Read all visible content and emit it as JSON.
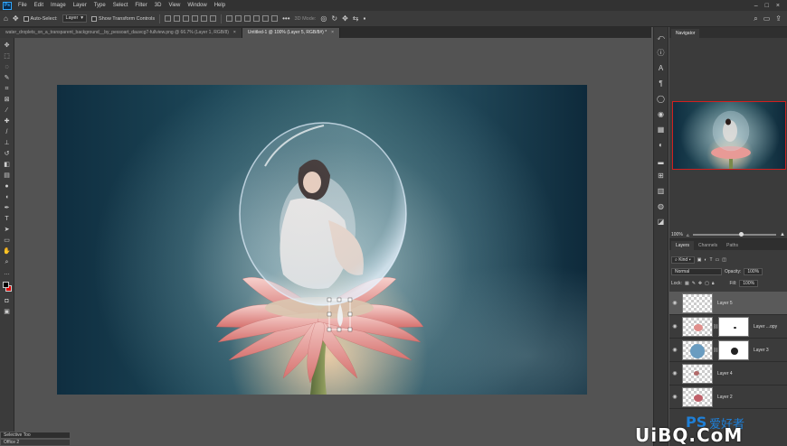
{
  "app": {
    "logo": "Ps",
    "menu": [
      "File",
      "Edit",
      "Image",
      "Layer",
      "Type",
      "Select",
      "Filter",
      "3D",
      "View",
      "Window",
      "Help"
    ]
  },
  "options_bar": {
    "auto_select_label": "Auto-Select:",
    "auto_select_target": "Layer",
    "show_transform_label": "Show Transform Controls",
    "mode_3d_label": "3D Mode:"
  },
  "tabs": [
    {
      "label": "water_droplets_on_a_transparent_background__by_pessoart_dauvcg7-fullview.png @ 66.7% (Layer 1, RGB/8)",
      "close": "×"
    },
    {
      "label": "Untitled-1 @ 100% (Layer 5, RGB/8#) *",
      "close": "×"
    }
  ],
  "colors": {
    "foreground": "#000000",
    "background": "#e00000",
    "accent": "#31a8ff"
  },
  "navigator": {
    "tabs": [
      "Navigator"
    ],
    "zoom": "100%"
  },
  "layers_panel": {
    "tabs": [
      "Layers",
      "Channels",
      "Paths"
    ],
    "filter_kind": "Kind",
    "blend_mode": "Normal",
    "opacity_label": "Opacity:",
    "opacity_value": "100%",
    "lock_label": "Lock:",
    "fill_label": "Fill:",
    "fill_value": "100%",
    "layers": [
      {
        "name": "Layer 5",
        "visible": true,
        "selected": true,
        "mask": false
      },
      {
        "name": "Layer ...opy",
        "visible": true,
        "selected": false,
        "mask": true
      },
      {
        "name": "Layer 3",
        "visible": true,
        "selected": false,
        "mask": true
      },
      {
        "name": "Layer 4",
        "visible": true,
        "selected": false,
        "mask": false
      },
      {
        "name": "Layer 2",
        "visible": true,
        "selected": false,
        "mask": false
      }
    ]
  },
  "bottom": {
    "selective": "Selective Too",
    "status": "Office 2"
  },
  "watermark": {
    "ps": "PS",
    "cn": "爱好者",
    "site": "UiBQ.CoM"
  }
}
